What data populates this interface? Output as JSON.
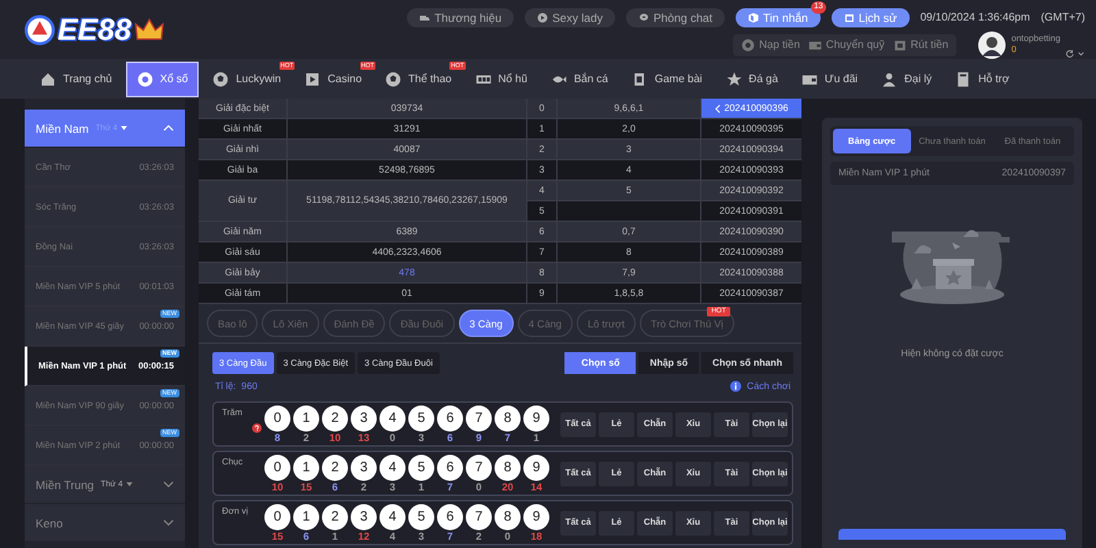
{
  "header": {
    "logo": "EE88",
    "links": [
      {
        "label": "Thương hiệu",
        "kind": "plain"
      },
      {
        "label": "Sexy lady",
        "kind": "plain"
      },
      {
        "label": "Phòng chat",
        "kind": "plain"
      },
      {
        "label": "Tin nhắn",
        "kind": "accent",
        "badge": "13"
      },
      {
        "label": "Lịch sử",
        "kind": "accent"
      }
    ],
    "datetime": "09/10/2024 1:36:46pm",
    "timezone": "(GMT+7)",
    "wallet": [
      "Nạp tiền",
      "Chuyển quỹ",
      "Rút tiền"
    ],
    "username": "ontopbetting",
    "balance": "0"
  },
  "nav": [
    {
      "label": "Trang chủ",
      "selected": false
    },
    {
      "label": "Xổ số",
      "selected": true
    },
    {
      "label": "Luckywin",
      "selected": false,
      "badge": "HOT"
    },
    {
      "label": "Casino",
      "selected": false,
      "badge": "HOT"
    },
    {
      "label": "Thể thao",
      "selected": false,
      "badge": "HOT"
    },
    {
      "label": "Nổ hũ",
      "selected": false
    },
    {
      "label": "Bắn cá",
      "selected": false
    },
    {
      "label": "Game bài",
      "selected": false
    },
    {
      "label": "Đá gà",
      "selected": false
    },
    {
      "label": "Ưu đãi",
      "selected": false
    },
    {
      "label": "Đại lý",
      "selected": false
    },
    {
      "label": "Hỗ trợ",
      "selected": false
    }
  ],
  "sidebar": {
    "regions": [
      {
        "name": "Miền Nam",
        "day": "Thứ 4",
        "expanded": true,
        "items": [
          {
            "name": "Cần Thơ",
            "time": "03:26:03",
            "selected": false
          },
          {
            "name": "Sóc Trăng",
            "time": "03:26:03",
            "selected": false
          },
          {
            "name": "Đồng Nai",
            "time": "03:26:03",
            "selected": false
          },
          {
            "name": "Miền Nam VIP 5 phút",
            "time": "00:01:03",
            "selected": false
          },
          {
            "name": "Miền Nam VIP 45 giây",
            "time": "00:00:00",
            "badge": "NEW",
            "selected": false
          },
          {
            "name": "Miền Nam VIP 1 phút",
            "time": "00:00:15",
            "badge": "NEW",
            "selected": true
          },
          {
            "name": "Miền Nam VIP 90 giây",
            "time": "00:00:00",
            "badge": "NEW",
            "selected": false
          },
          {
            "name": "Miền Nam VIP 2 phút",
            "time": "00:00:00",
            "badge": "NEW",
            "selected": false
          }
        ]
      },
      {
        "name": "Miền Trung",
        "day": "Thứ 4",
        "expanded": false
      },
      {
        "name": "Keno",
        "expanded": false
      }
    ]
  },
  "results": {
    "rows": [
      {
        "prize": {
          "name": "Giải đặc biệt",
          "numbers": "039734",
          "highlighted": false
        },
        "digit": "0",
        "tails": "9,6,6,1",
        "draw": "202410090396",
        "selected": true
      },
      {
        "prize": {
          "name": "Giải nhất",
          "numbers": "31291",
          "highlighted": false
        },
        "digit": "1",
        "tails": "2,0",
        "draw": "202410090395",
        "selected": false
      },
      {
        "prize": {
          "name": "Giải nhì",
          "numbers": "40087",
          "highlighted": false
        },
        "digit": "2",
        "tails": "3",
        "draw": "202410090394",
        "selected": false
      },
      {
        "prize": {
          "name": "Giải ba",
          "numbers": "52498,76895",
          "highlighted": false
        },
        "digit": "3",
        "tails": "4",
        "draw": "202410090393",
        "selected": false
      },
      {
        "prize": {
          "name": "Giải tư",
          "numbers": "51198,78112,54345,38210,78460,23267,15909",
          "highlighted": false
        },
        "digit": "4",
        "tails": "5",
        "draw": "202410090392",
        "selected": false
      },
      {
        "digit": "5",
        "draw": "202410090391",
        "selected": false
      },
      {
        "prize": {
          "name": "Giải năm",
          "numbers": "6389",
          "highlighted": false
        },
        "digit": "6",
        "tails": "0,7",
        "draw": "202410090390",
        "selected": false
      },
      {
        "prize": {
          "name": "Giải sáu",
          "numbers": "4406,2323,4606",
          "highlighted": false
        },
        "digit": "7",
        "tails": "8",
        "draw": "202410090389",
        "selected": false
      },
      {
        "prize": {
          "name": "Giải bảy",
          "numbers": "478",
          "highlighted": true
        },
        "digit": "8",
        "tails": "7,9",
        "draw": "202410090388",
        "selected": false
      },
      {
        "prize": {
          "name": "Giải tám",
          "numbers": "01",
          "highlighted": false
        },
        "digit": "9",
        "tails": "1,8,5,8",
        "draw": "202410090387",
        "selected": false
      }
    ]
  },
  "game_tabs": [
    {
      "label": "Bao lô",
      "selected": false
    },
    {
      "label": "Lô Xiên",
      "selected": false
    },
    {
      "label": "Đánh Đề",
      "selected": false
    },
    {
      "label": "Đầu Đuôi",
      "selected": false
    },
    {
      "label": "3 Càng",
      "selected": true
    },
    {
      "label": "4 Càng",
      "selected": false
    },
    {
      "label": "Lô trượt",
      "selected": false
    },
    {
      "label": "Trò Chơi Thú Vị",
      "selected": false,
      "badge": "HOT"
    }
  ],
  "sub_tabs": [
    {
      "label": "3 Càng Đầu",
      "selected": true
    },
    {
      "label": "3 Càng Đặc Biệt",
      "selected": false
    },
    {
      "label": "3 Càng Đầu Đuôi",
      "selected": false
    }
  ],
  "modes": [
    {
      "label": "Chọn số",
      "selected": true
    },
    {
      "label": "Nhập số",
      "selected": false
    },
    {
      "label": "Chọn số nhanh",
      "selected": false
    }
  ],
  "ratio_label": "Tỉ lệ:",
  "ratio": "960",
  "help_link": "Cách chơi",
  "positions": [
    {
      "label": "Trăm",
      "help": true,
      "quick_buttons": [
        "Tất cả",
        "Lẻ",
        "Chẵn",
        "Xỉu",
        "Tài",
        "Chọn lại"
      ],
      "balls": [
        {
          "digit": "0",
          "count": "8",
          "color": "#8a93f0"
        },
        {
          "digit": "1",
          "count": "2",
          "color": "#9a9a9a"
        },
        {
          "digit": "2",
          "count": "10",
          "color": "#e04848"
        },
        {
          "digit": "3",
          "count": "13",
          "color": "#e04848"
        },
        {
          "digit": "4",
          "count": "0",
          "color": "#9a9a9a"
        },
        {
          "digit": "5",
          "count": "3",
          "color": "#9a9a9a"
        },
        {
          "digit": "6",
          "count": "6",
          "color": "#8a93f0"
        },
        {
          "digit": "7",
          "count": "9",
          "color": "#8a93f0"
        },
        {
          "digit": "8",
          "count": "7",
          "color": "#8a93f0"
        },
        {
          "digit": "9",
          "count": "1",
          "color": "#9a9a9a"
        }
      ]
    },
    {
      "label": "Chục",
      "quick_buttons": [
        "Tất cả",
        "Lẻ",
        "Chẵn",
        "Xỉu",
        "Tài",
        "Chọn lại"
      ],
      "balls": [
        {
          "digit": "0",
          "count": "10",
          "color": "#e04848"
        },
        {
          "digit": "1",
          "count": "15",
          "color": "#e04848"
        },
        {
          "digit": "2",
          "count": "6",
          "color": "#8a93f0"
        },
        {
          "digit": "3",
          "count": "2",
          "color": "#9a9a9a"
        },
        {
          "digit": "4",
          "count": "3",
          "color": "#9a9a9a"
        },
        {
          "digit": "5",
          "count": "1",
          "color": "#9a9a9a"
        },
        {
          "digit": "6",
          "count": "7",
          "color": "#8a93f0"
        },
        {
          "digit": "7",
          "count": "0",
          "color": "#9a9a9a"
        },
        {
          "digit": "8",
          "count": "20",
          "color": "#e04848"
        },
        {
          "digit": "9",
          "count": "14",
          "color": "#e04848"
        }
      ]
    },
    {
      "label": "Đơn vị",
      "quick_buttons": [
        "Tất cả",
        "Lẻ",
        "Chẵn",
        "Xỉu",
        "Tài",
        "Chọn lại"
      ],
      "balls": [
        {
          "digit": "0",
          "count": "15",
          "color": "#e04848"
        },
        {
          "digit": "1",
          "count": "6",
          "color": "#8a93f0"
        },
        {
          "digit": "2",
          "count": "1",
          "color": "#9a9a9a"
        },
        {
          "digit": "3",
          "count": "12",
          "color": "#e04848"
        },
        {
          "digit": "4",
          "count": "4",
          "color": "#9a9a9a"
        },
        {
          "digit": "5",
          "count": "3",
          "color": "#9a9a9a"
        },
        {
          "digit": "6",
          "count": "7",
          "color": "#8a93f0"
        },
        {
          "digit": "7",
          "count": "2",
          "color": "#9a9a9a"
        },
        {
          "digit": "8",
          "count": "0",
          "color": "#9a9a9a"
        },
        {
          "digit": "9",
          "count": "18",
          "color": "#e04848"
        }
      ]
    }
  ],
  "bet_panel": {
    "tabs": [
      {
        "label": "Bảng cược",
        "selected": true
      },
      {
        "label": "Chưa thanh toán",
        "selected": false
      },
      {
        "label": "Đã thanh toán",
        "selected": false
      }
    ],
    "game": "Miền Nam VIP 1 phút",
    "draw": "202410090397",
    "empty_text": "Hiện không có đặt cược"
  }
}
